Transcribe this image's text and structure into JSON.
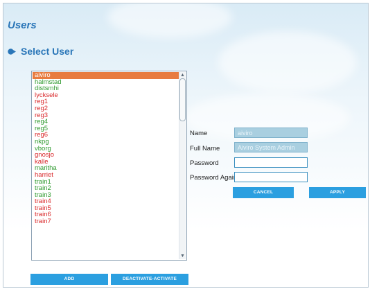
{
  "header": {
    "title": "Users",
    "section_title": "Select User"
  },
  "user_list": {
    "items": [
      {
        "label": "aiviro",
        "status": "selected"
      },
      {
        "label": "halmstad",
        "status": "green"
      },
      {
        "label": "distsmhi",
        "status": "green"
      },
      {
        "label": "lycksele",
        "status": "red"
      },
      {
        "label": "reg1",
        "status": "red"
      },
      {
        "label": "reg2",
        "status": "red"
      },
      {
        "label": "reg3",
        "status": "red"
      },
      {
        "label": "reg4",
        "status": "green"
      },
      {
        "label": "reg5",
        "status": "green"
      },
      {
        "label": "reg6",
        "status": "red"
      },
      {
        "label": "nkpg",
        "status": "green"
      },
      {
        "label": "vborg",
        "status": "green"
      },
      {
        "label": "gnosjo",
        "status": "red"
      },
      {
        "label": "kalle",
        "status": "red"
      },
      {
        "label": "maritha",
        "status": "green"
      },
      {
        "label": "harriet",
        "status": "red"
      },
      {
        "label": "train1",
        "status": "green"
      },
      {
        "label": "train2",
        "status": "green"
      },
      {
        "label": "train3",
        "status": "green"
      },
      {
        "label": "train4",
        "status": "red"
      },
      {
        "label": "train5",
        "status": "red"
      },
      {
        "label": "train6",
        "status": "red"
      },
      {
        "label": "train7",
        "status": "red"
      }
    ]
  },
  "form": {
    "name_label": "Name",
    "name_value": "aiviro",
    "fullname_label": "Full Name",
    "fullname_value": "Aiviro System Admin",
    "password_label": "Password",
    "password_value": "",
    "password_again_label": "Password Again",
    "password_again_value": ""
  },
  "buttons": {
    "cancel": "CANCEL",
    "apply": "APPLY",
    "add": "ADD",
    "deactivate": "DEACTIVATE-ACTIVATE"
  },
  "colors": {
    "accent": "#2a76b8",
    "button": "#2b9fe0",
    "selected": "#e87b3f",
    "active": "#2f9a2f",
    "inactive": "#d9282a"
  },
  "icons": {
    "section_bullet": "bullet-icon"
  }
}
